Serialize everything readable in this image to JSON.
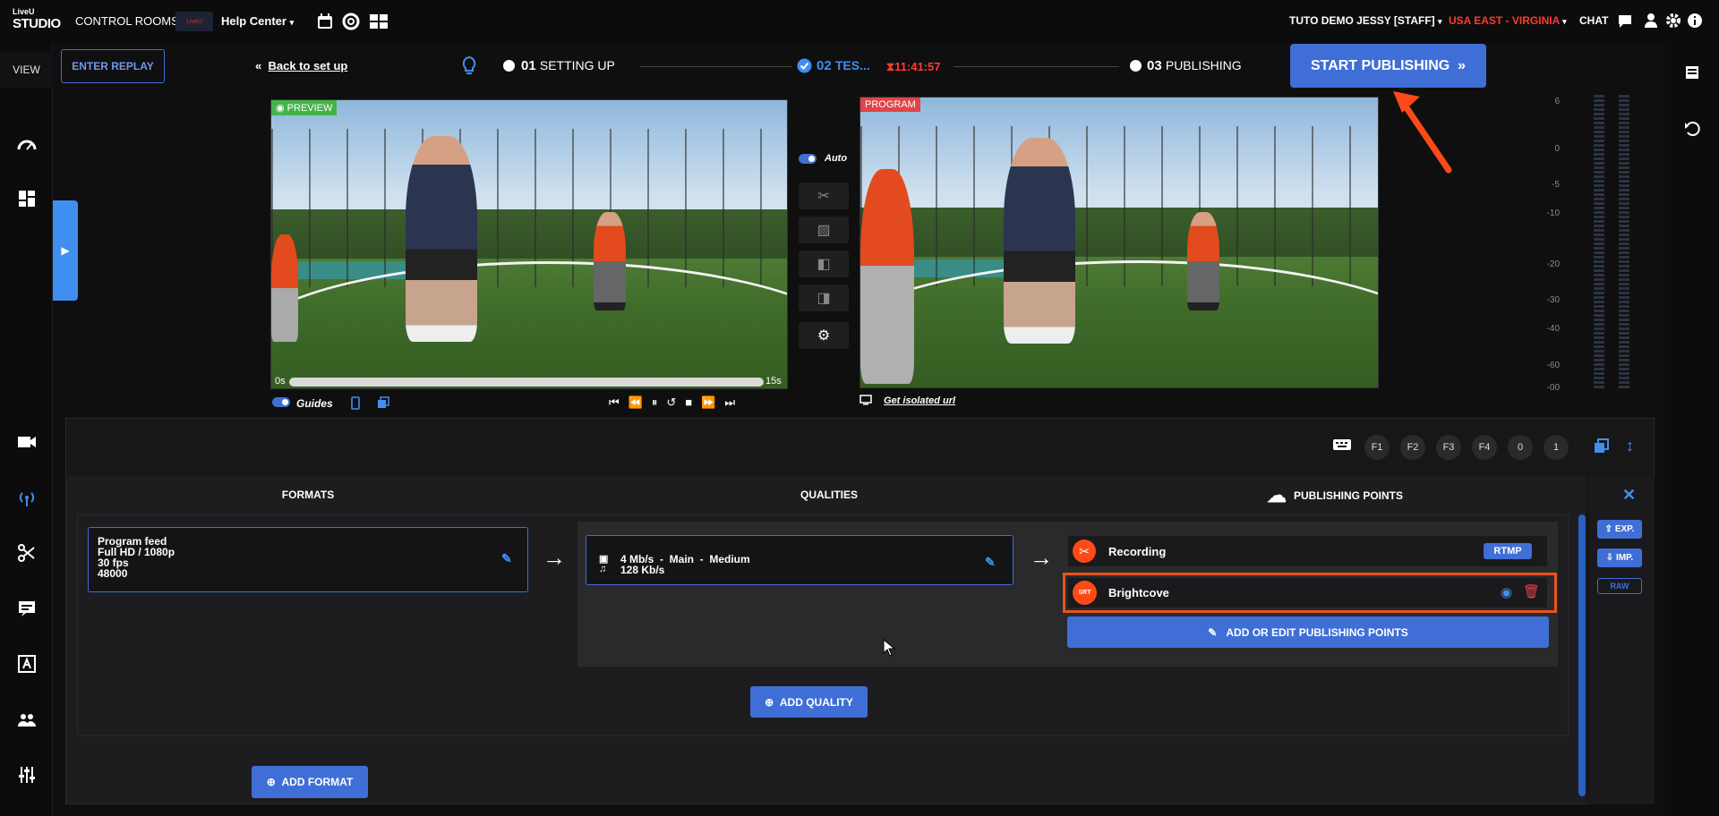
{
  "topbar": {
    "logo_line1": "LiveU",
    "logo_line2": "STUDIO",
    "control_rooms": "CONTROL ROOMS",
    "workspace_badge": "LiveU",
    "help_center": "Help Center",
    "user": "TUTO DEMO JESSY [STAFF]",
    "region": "USA EAST - VIRGINIA",
    "chat": "CHAT",
    "region_color": "#ff3b2f"
  },
  "sidebar": {
    "view_label": "VIEW",
    "icons": [
      "dashboard-icon",
      "layout-icon",
      "camera-icon",
      "broadcast-icon",
      "scissors-icon",
      "caption-icon",
      "text-icon",
      "team-icon",
      "mixer-icon"
    ]
  },
  "steps": {
    "replay": "ENTER REPLAY",
    "back": "Back to set up",
    "step1_num": "01",
    "step1_label": "SETTING UP",
    "step2_num": "02",
    "step2_label": "TES...",
    "timer": "11:41:57",
    "step3_num": "03",
    "step3_label": "PUBLISHING",
    "start_publishing": "START PUBLISHING"
  },
  "preview": {
    "label": "PREVIEW",
    "start": "0s",
    "end": "15s",
    "guides": "Guides",
    "progress": 0.0
  },
  "program": {
    "label": "PROGRAM",
    "isolated_url": "Get isolated url"
  },
  "middle": {
    "auto": "Auto"
  },
  "audio_scale": [
    "6",
    "0",
    "-5",
    "-10",
    "-20",
    "-30",
    "-40",
    "-60",
    "-00"
  ],
  "shortcuts": [
    "F1",
    "F2",
    "F3",
    "F4",
    "0",
    "1"
  ],
  "publishing": {
    "formats_header": "FORMATS",
    "qualities_header": "QUALITIES",
    "points_header": "PUBLISHING POINTS",
    "format": {
      "name": "Program feed",
      "resolution": "Full HD / 1080p",
      "fps": "30 fps",
      "audio": "48000"
    },
    "quality": {
      "video": "4 Mb/s  -  Main  -  Medium",
      "audio": "128 Kb/s"
    },
    "points": [
      {
        "name": "Recording",
        "badge": "RTMP"
      },
      {
        "name": "Brightcove",
        "badge": "SRT"
      }
    ],
    "add_edit_points": "ADD OR EDIT PUBLISHING POINTS",
    "add_quality": "ADD QUALITY",
    "add_format": "ADD FORMAT",
    "exp": "EXP.",
    "imp": "IMP.",
    "raw": "RAW"
  }
}
